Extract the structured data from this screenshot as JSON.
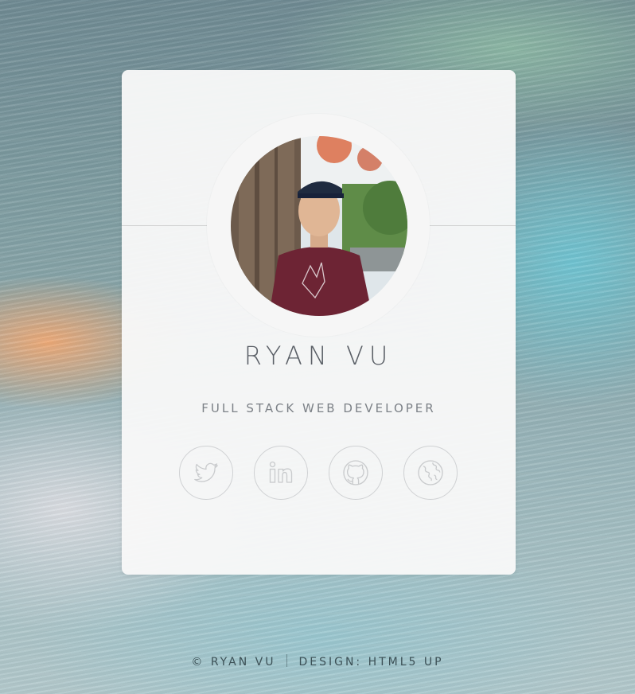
{
  "profile": {
    "name": "RYAN VU",
    "role": "FULL STACK WEB DEVELOPER",
    "avatar_alt": "Ryan Vu"
  },
  "social": [
    {
      "name": "twitter",
      "icon": "twitter-icon"
    },
    {
      "name": "linkedin",
      "icon": "linkedin-icon"
    },
    {
      "name": "github",
      "icon": "github-icon"
    },
    {
      "name": "website",
      "icon": "globe-icon"
    }
  ],
  "footer": {
    "copyright": "© RYAN VU",
    "design": "DESIGN: HTML5 UP"
  },
  "colors": {
    "card": "#f8f8f8",
    "text": "#5a5f66",
    "icon_stroke": "#c9cbcd"
  }
}
